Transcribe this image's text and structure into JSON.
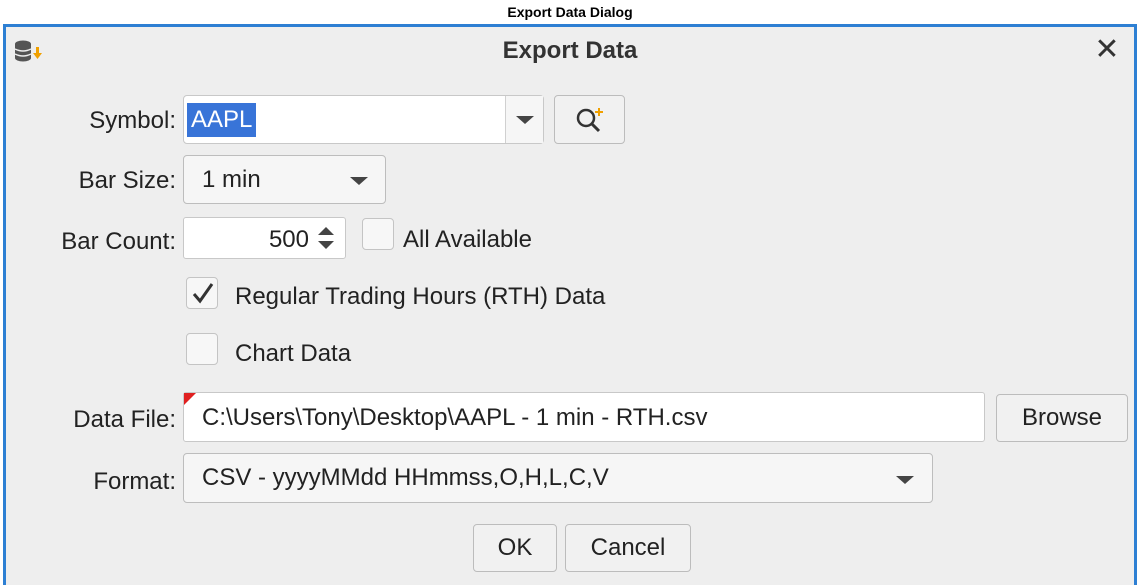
{
  "caption": "Export Data Dialog",
  "dialog": {
    "title": "Export Data",
    "close_icon": "close-icon",
    "app_icon": "database-export-icon"
  },
  "symbol": {
    "label": "Symbol:",
    "value": "AAPL",
    "search_icon": "search-add-icon"
  },
  "bar_size": {
    "label": "Bar Size:",
    "value": "1 min"
  },
  "bar_count": {
    "label": "Bar Count:",
    "value": "500",
    "all_available_label": "All Available",
    "all_available_checked": false
  },
  "rth": {
    "label": "Regular Trading Hours (RTH) Data",
    "checked": true
  },
  "chart_data": {
    "label": "Chart Data",
    "checked": false
  },
  "data_file": {
    "label": "Data File:",
    "value": "C:\\Users\\Tony\\Desktop\\AAPL - 1 min - RTH.csv",
    "browse_label": "Browse"
  },
  "format": {
    "label": "Format:",
    "value": "CSV - yyyyMMdd HHmmss,O,H,L,C,V"
  },
  "buttons": {
    "ok": "OK",
    "cancel": "Cancel"
  },
  "colors": {
    "accent": "#2d7fd3",
    "selection": "#3874d8",
    "background": "#eeeeee"
  }
}
